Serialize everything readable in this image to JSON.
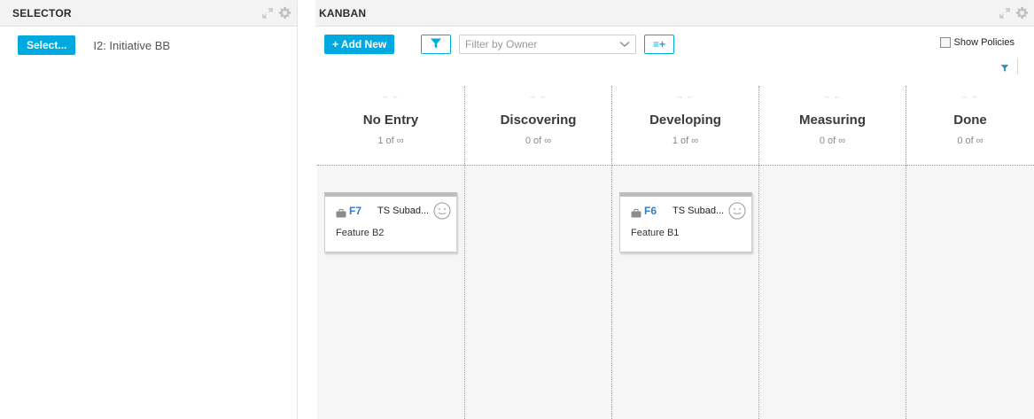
{
  "selector": {
    "title": "SELECTOR",
    "select_label": "Select...",
    "value": "I2: Initiative BB"
  },
  "kanban": {
    "title": "KANBAN",
    "add_label": "+ Add New",
    "owner_placeholder": "Filter by Owner",
    "fields_label": "≡+",
    "show_policies": "Show Policies",
    "show_policies_checked": false,
    "columns": [
      {
        "title": "No Entry",
        "count": "1 of ∞",
        "collapse": "→ ←"
      },
      {
        "title": "Discovering",
        "count": "0 of ∞",
        "collapse": "→ ←"
      },
      {
        "title": "Developing",
        "count": "1 of ∞",
        "collapse": "→ ←"
      },
      {
        "title": "Measuring",
        "count": "0 of ∞",
        "collapse": "→ ←"
      },
      {
        "title": "Done",
        "count": "0 of ∞",
        "collapse": "→ ←"
      }
    ],
    "cards": {
      "no_entry": {
        "id": "F7",
        "owner": "TS Subad...",
        "name": "Feature B2",
        "type_icon": "briefcase-icon",
        "avatar_icon": "smiley-icon"
      },
      "developing": {
        "id": "F6",
        "owner": "TS Subad...",
        "name": "Feature B1",
        "type_icon": "briefcase-icon",
        "avatar_icon": "smiley-icon"
      }
    }
  },
  "colors": {
    "accent": "#00a9e0",
    "card_id": "#2f7fc9",
    "lane_bg": "#f6f6f6",
    "header_bg": "#f3f3f3"
  }
}
